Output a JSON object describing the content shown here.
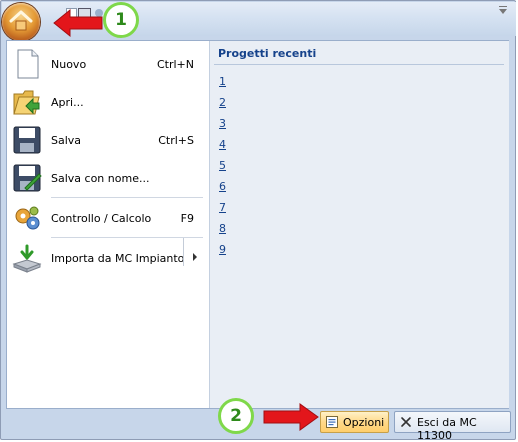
{
  "app": {
    "orb": "app-orb-house-icon"
  },
  "menu": {
    "items": [
      {
        "label": "Nuovo",
        "shortcut": "Ctrl+N",
        "icon": "new-document-icon"
      },
      {
        "label": "Apri...",
        "shortcut": "",
        "icon": "open-folder-icon"
      },
      {
        "label": "Salva",
        "shortcut": "Ctrl+S",
        "icon": "save-floppy-icon"
      },
      {
        "label": "Salva con nome...",
        "shortcut": "",
        "icon": "save-as-icon"
      },
      {
        "label": "Controllo / Calcolo",
        "shortcut": "F9",
        "icon": "gears-icon"
      },
      {
        "label": "Importa da MC Impianto",
        "shortcut": "",
        "icon": "import-icon"
      }
    ]
  },
  "recent": {
    "title": "Progetti recenti",
    "items": [
      "1",
      "2",
      "3",
      "4",
      "5",
      "6",
      "7",
      "8",
      "9"
    ]
  },
  "buttons": {
    "options": "Opzioni",
    "exit": "Esci da MC 11300"
  },
  "annotations": {
    "callout_1": "1",
    "callout_2": "2"
  },
  "colors": {
    "accent": "#15428b",
    "annotation_arrow": "#e3161b",
    "annotation_ring": "#7fd84a"
  }
}
